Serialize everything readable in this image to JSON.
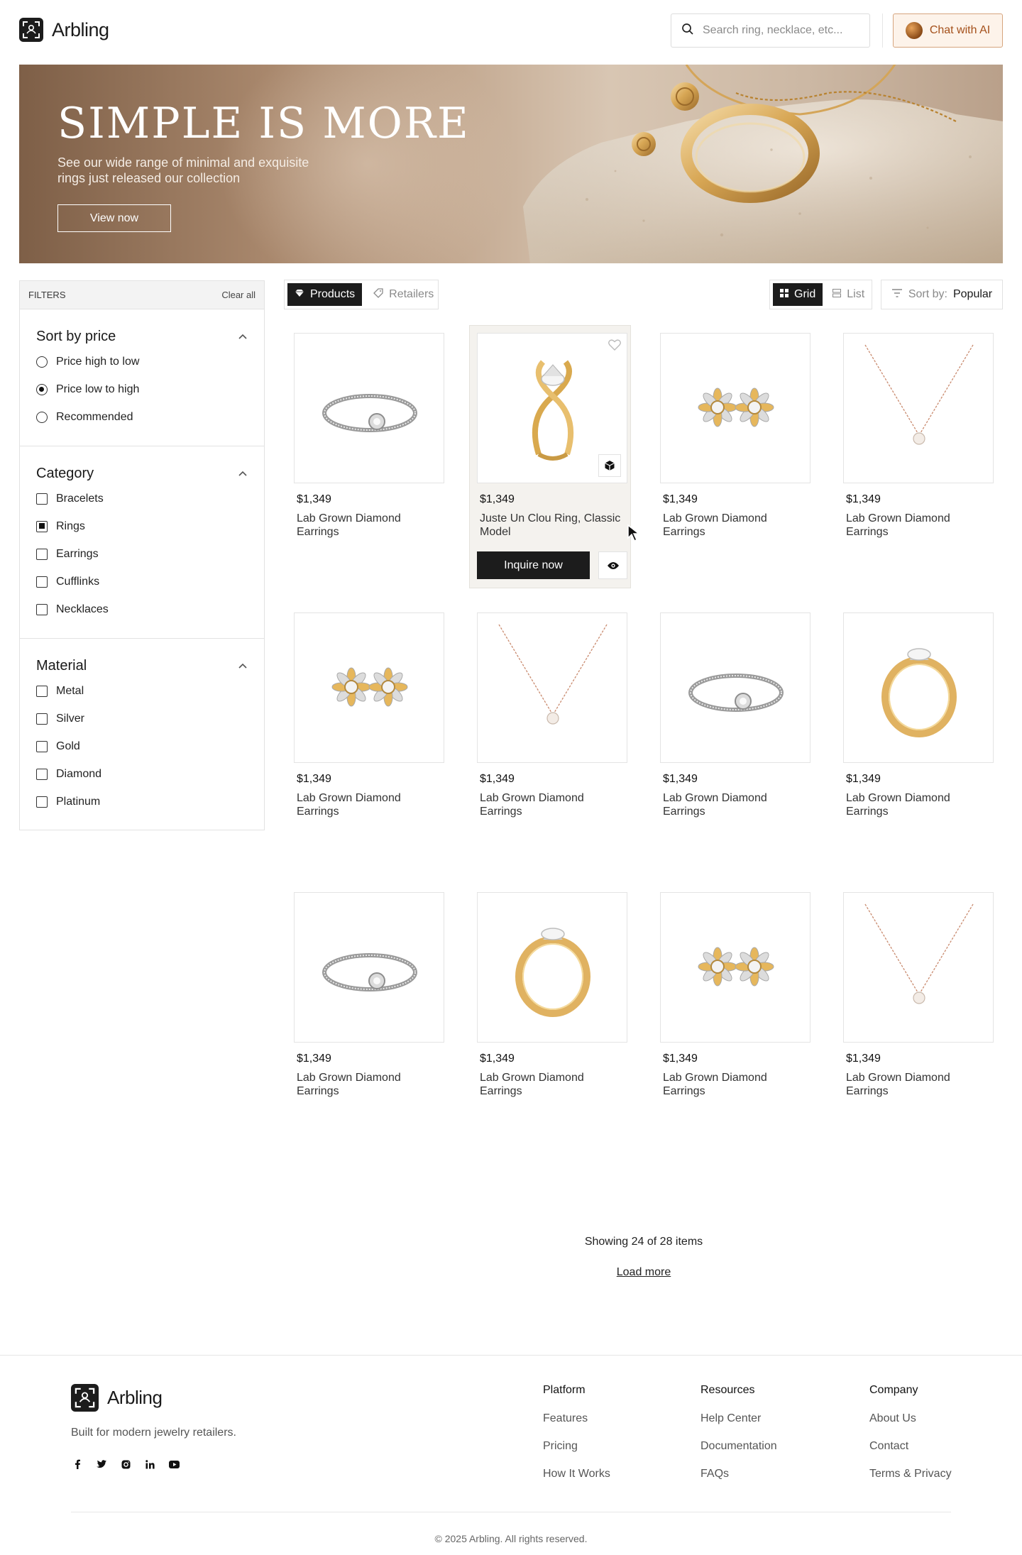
{
  "header": {
    "brand": "Arbling",
    "search_placeholder": "Search ring, necklace, etc...",
    "chat_label": "Chat with AI"
  },
  "hero": {
    "title": "SIMPLE IS MORE",
    "subtitle": "See our wide range of minimal and exquisite rings just released our collection",
    "cta": "View now"
  },
  "filters": {
    "heading": "FILTERS",
    "clear": "Clear all",
    "sort": {
      "title": "Sort by price",
      "options": [
        {
          "label": "Price high to low",
          "selected": false
        },
        {
          "label": "Price low to high",
          "selected": true
        },
        {
          "label": "Recommended",
          "selected": false
        }
      ]
    },
    "category": {
      "title": "Category",
      "options": [
        {
          "label": "Bracelets",
          "checked": false
        },
        {
          "label": "Rings",
          "checked": true
        },
        {
          "label": "Earrings",
          "checked": false
        },
        {
          "label": "Cufflinks",
          "checked": false
        },
        {
          "label": "Necklaces",
          "checked": false
        }
      ]
    },
    "material": {
      "title": "Material",
      "options": [
        {
          "label": "Metal",
          "checked": false
        },
        {
          "label": "Silver",
          "checked": false
        },
        {
          "label": "Gold",
          "checked": false
        },
        {
          "label": "Diamond",
          "checked": false
        },
        {
          "label": "Platinum",
          "checked": false
        }
      ]
    }
  },
  "toolbar": {
    "tabs": [
      {
        "label": "Products",
        "active": true,
        "icon": "diamond-icon"
      },
      {
        "label": "Retailers",
        "active": false,
        "icon": "tag-icon"
      }
    ],
    "views": [
      {
        "label": "Grid",
        "active": true,
        "icon": "grid-icon"
      },
      {
        "label": "List",
        "active": false,
        "icon": "list-icon"
      }
    ],
    "sort_label": "Sort by:",
    "sort_value": "Popular"
  },
  "products": [
    {
      "price": "$1,349",
      "name": "Lab Grown Diamond Earrings",
      "image": "bracelet"
    },
    {
      "price": "$1,349",
      "name": "Juste Un Clou Ring, Classic Model",
      "image": "twist-ring",
      "hover": true,
      "inquire": "Inquire now"
    },
    {
      "price": "$1,349",
      "name": "Lab Grown Diamond Earrings",
      "image": "earrings"
    },
    {
      "price": "$1,349",
      "name": "Lab Grown Diamond Earrings",
      "image": "necklace"
    },
    {
      "price": "$1,349",
      "name": "Lab Grown Diamond Earrings",
      "image": "earrings"
    },
    {
      "price": "$1,349",
      "name": "Lab Grown Diamond Earrings",
      "image": "necklace"
    },
    {
      "price": "$1,349",
      "name": "Lab Grown Diamond Earrings",
      "image": "bracelet"
    },
    {
      "price": "$1,349",
      "name": "Lab Grown Diamond Earrings",
      "image": "ring"
    },
    {
      "price": "$1,349",
      "name": "Lab Grown Diamond Earrings",
      "image": "bracelet"
    },
    {
      "price": "$1,349",
      "name": "Lab Grown Diamond Earrings",
      "image": "ring"
    },
    {
      "price": "$1,349",
      "name": "Lab Grown Diamond Earrings",
      "image": "earrings"
    },
    {
      "price": "$1,349",
      "name": "Lab Grown Diamond Earrings",
      "image": "necklace"
    }
  ],
  "pagination": {
    "showing": "Showing 24 of 28 items",
    "load_more": "Load more"
  },
  "footer": {
    "brand": "Arbling",
    "tagline": "Built for modern jewelry retailers.",
    "social": [
      "facebook-icon",
      "twitter-icon",
      "instagram-icon",
      "linkedin-icon",
      "youtube-icon"
    ],
    "columns": [
      {
        "heading": "Platform",
        "links": [
          "Features",
          "Pricing",
          "How It Works"
        ]
      },
      {
        "heading": "Resources",
        "links": [
          "Help Center",
          "Documentation",
          "FAQs"
        ]
      },
      {
        "heading": "Company",
        "links": [
          "About Us",
          "Contact",
          "Terms & Privacy"
        ]
      }
    ],
    "copyright": "© 2025 Arbling. All rights reserved."
  },
  "colors": {
    "accent_orange": "#a4501b",
    "dark": "#1c1c1c",
    "gold": "#d9a94e"
  }
}
